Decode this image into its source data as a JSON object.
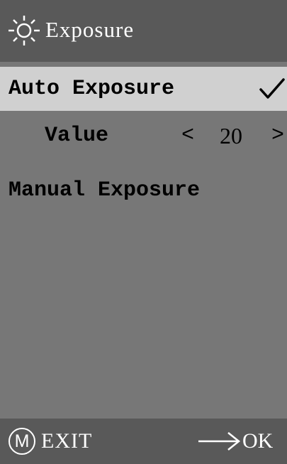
{
  "header": {
    "icon": "sun-icon",
    "title": "Exposure"
  },
  "menu": {
    "auto_exposure": {
      "label": "Auto Exposure",
      "selected": true,
      "check_icon": "checkmark-icon"
    },
    "value": {
      "label": "Value",
      "left_arrow": "<",
      "number": "20",
      "right_arrow": ">"
    },
    "manual_exposure": {
      "label": "Manual Exposure"
    }
  },
  "footer": {
    "m_icon": "M",
    "exit_label": "EXIT",
    "arrow_icon": "right-arrow-icon",
    "ok_label": "OK"
  },
  "colors": {
    "header_bg": "#595959",
    "body_bg": "#777777",
    "selected_bg": "#d0d0d0",
    "text_light": "#ffffff",
    "text_dark": "#000000"
  }
}
